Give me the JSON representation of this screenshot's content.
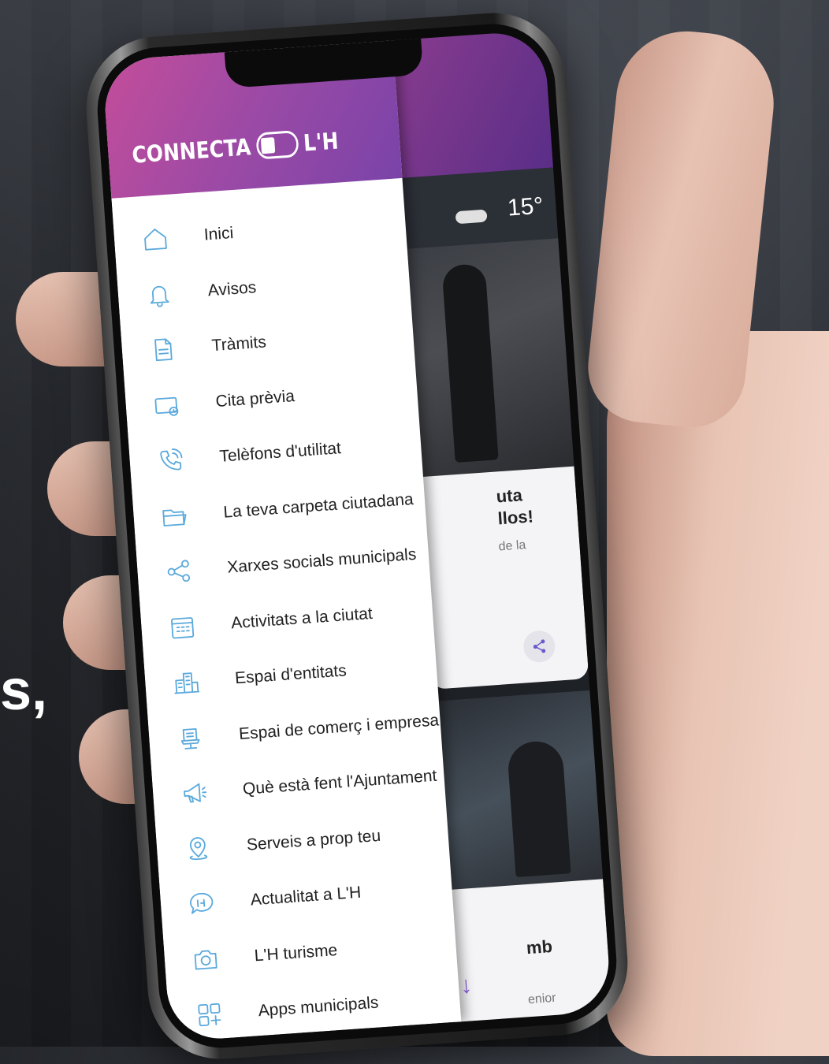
{
  "app": {
    "brand_left": "CONNECTA",
    "brand_right": "L'H",
    "colors": {
      "header_start": "#c44d9a",
      "header_end": "#7a43a8",
      "icon": "#5aa9dc",
      "accent": "#7a4fc9"
    }
  },
  "menu": {
    "items": [
      {
        "label": "Inici",
        "icon": "home-icon"
      },
      {
        "label": "Avisos",
        "icon": "bell-icon"
      },
      {
        "label": "Tràmits",
        "icon": "document-icon"
      },
      {
        "label": "Cita prèvia",
        "icon": "calendar-clock-icon"
      },
      {
        "label": "Telèfons d'utilitat",
        "icon": "phone-icon"
      },
      {
        "label": "La teva carpeta ciutadana",
        "icon": "folder-icon"
      },
      {
        "label": "Xarxes socials municipals",
        "icon": "share-icon"
      },
      {
        "label": "Activitats a la ciutat",
        "icon": "calendar-icon"
      },
      {
        "label": "Espai d'entitats",
        "icon": "buildings-icon"
      },
      {
        "label": "Espai de comerç i empresa",
        "icon": "shop-icon"
      },
      {
        "label": "Què està fent l'Ajuntament",
        "icon": "megaphone-icon"
      },
      {
        "label": "Serveis a prop teu",
        "icon": "location-icon"
      },
      {
        "label": "Actualitat a L'H",
        "icon": "chat-icon"
      },
      {
        "label": "L'H turisme",
        "icon": "camera-icon"
      },
      {
        "label": "Apps municipals",
        "icon": "apps-grid-icon"
      }
    ]
  },
  "background_app": {
    "weather_temp": "15°",
    "card_title": "uta\nllos!",
    "card_subtitle": "de la",
    "card2_title": "mb",
    "card2_subtitle": "enior"
  },
  "scroll_arrow": "↓",
  "page_edge_text": "s,"
}
